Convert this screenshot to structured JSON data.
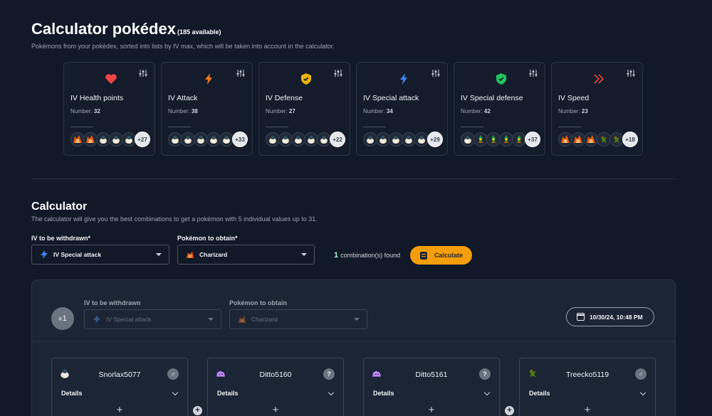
{
  "header": {
    "title": "Calculator pokédex",
    "available": "(185 available)",
    "subtitle": "Pokémons from your pokédex, sorted into lists by IV max, which will be taken into account in the calculator."
  },
  "iv_cards": [
    {
      "label": "IV Health points",
      "number_label": "Number:",
      "number": "32",
      "icon": "heart-icon",
      "color": "#ef4444",
      "more": "+27",
      "avatars": [
        "charizard",
        "charizard",
        "snorlax",
        "snorlax",
        "snorlax"
      ]
    },
    {
      "label": "IV Attack",
      "number_label": "Number:",
      "number": "38",
      "icon": "bolt-icon",
      "color": "#f97316",
      "more": "+33",
      "avatars": [
        "snorlax",
        "snorlax",
        "snorlax",
        "snorlax",
        "snorlax"
      ]
    },
    {
      "label": "IV Defense",
      "number_label": "Number:",
      "number": "27",
      "icon": "shield-icon",
      "color": "#eab308",
      "more": "+22",
      "avatars": [
        "snorlax",
        "snorlax",
        "snorlax",
        "snorlax",
        "snorlax"
      ]
    },
    {
      "label": "IV Special attack",
      "number_label": "Number:",
      "number": "34",
      "icon": "bolt-icon",
      "color": "#3b82f6",
      "more": "+29",
      "avatars": [
        "snorlax",
        "snorlax",
        "snorlax",
        "snorlax",
        "snorlax"
      ]
    },
    {
      "label": "IV Special defense",
      "number_label": "Number:",
      "number": "42",
      "icon": "shield-icon",
      "color": "#22c55e",
      "more": "+37",
      "avatars": [
        "snorlax",
        "sceptile",
        "sceptile",
        "sceptile",
        "sceptile"
      ]
    },
    {
      "label": "IV Speed",
      "number_label": "Number:",
      "number": "23",
      "icon": "double-chevron-icon",
      "color": "#ef4444",
      "more": "+18",
      "avatars": [
        "charizard",
        "charizard",
        "charizard",
        "treecko",
        "treecko"
      ]
    }
  ],
  "calculator": {
    "title": "Calculator",
    "subtitle": "The calculator will give you the best combinations to get a pokémon with 5 individual values up to 31.",
    "iv_label": "IV to be withdrawn*",
    "iv_value": "IV Special attack",
    "pokemon_label": "Pokémon to obtain*",
    "pokemon_value": "Charizard",
    "combinations_count": "1",
    "combinations_text": "combination(s) found",
    "calculate_label": "Calculate"
  },
  "result": {
    "rank_prefix": "#",
    "rank": "1",
    "iv_label": "IV to be withdrawn",
    "iv_value": "IV Special attack",
    "pokemon_label": "Pokémon to obtain",
    "pokemon_value": "Charizard",
    "date": "10/30/24, 10:48 PM",
    "pokemons": [
      {
        "name": "Snorlax5077",
        "gender": "♂",
        "details": "Details",
        "avatar": "snorlax"
      },
      {
        "name": "Ditto5160",
        "gender": "?",
        "details": "Details",
        "avatar": "ditto"
      },
      {
        "name": "Ditto5161",
        "gender": "?",
        "details": "Details",
        "avatar": "ditto"
      },
      {
        "name": "Treecko5119",
        "gender": "♂",
        "details": "Details",
        "avatar": "treecko"
      }
    ],
    "plus": "+"
  },
  "colors": {
    "accent": "#f59e0b",
    "background": "#111827",
    "panel": "#1b2535"
  }
}
